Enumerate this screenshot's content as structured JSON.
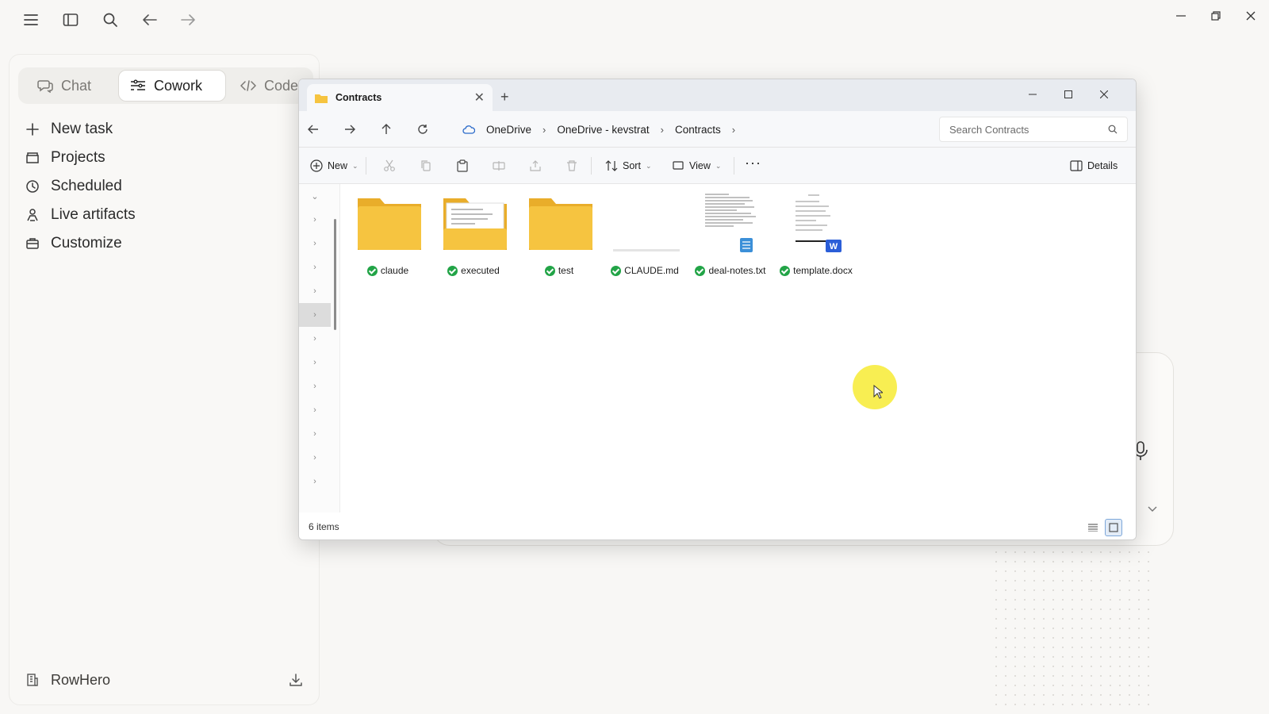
{
  "app": {
    "icons": [
      "menu-icon",
      "sidebar-toggle-icon",
      "search-icon",
      "back-icon",
      "forward-icon"
    ]
  },
  "sidebar": {
    "modes": [
      {
        "label": "Chat",
        "icon": "chat-icon"
      },
      {
        "label": "Cowork",
        "icon": "cowork-icon",
        "active": true
      },
      {
        "label": "Code",
        "icon": "code-icon"
      }
    ],
    "items": [
      {
        "label": "New task",
        "icon": "plus-icon"
      },
      {
        "label": "Projects",
        "icon": "folder-icon"
      },
      {
        "label": "Scheduled",
        "icon": "clock-icon"
      },
      {
        "label": "Live artifacts",
        "icon": "artifact-icon"
      },
      {
        "label": "Customize",
        "icon": "briefcase-icon"
      }
    ],
    "footer": {
      "label": "RowHero",
      "icon": "building-icon",
      "action_icon": "download-icon"
    }
  },
  "explorer": {
    "tab_title": "Contracts",
    "breadcrumbs": [
      "OneDrive",
      "OneDrive - kevstrat",
      "Contracts"
    ],
    "search_placeholder": "Search Contracts",
    "commands": {
      "new": "New",
      "sort": "Sort",
      "view": "View",
      "details": "Details"
    },
    "files": [
      {
        "name": "claude",
        "type": "folder",
        "synced": true
      },
      {
        "name": "executed",
        "type": "folder-with-docs",
        "synced": true
      },
      {
        "name": "test",
        "type": "folder",
        "synced": true
      },
      {
        "name": "CLAUDE.md",
        "type": "md",
        "synced": true
      },
      {
        "name": "deal-notes.txt",
        "type": "txt",
        "synced": true
      },
      {
        "name": "template.docx",
        "type": "docx",
        "synced": true
      }
    ],
    "status": "6 items"
  },
  "colors": {
    "folder": "#f6c440",
    "sync_ok": "#22a447",
    "cursor_highlight": "#f7ec3a",
    "word_blue": "#2b5ed8"
  }
}
